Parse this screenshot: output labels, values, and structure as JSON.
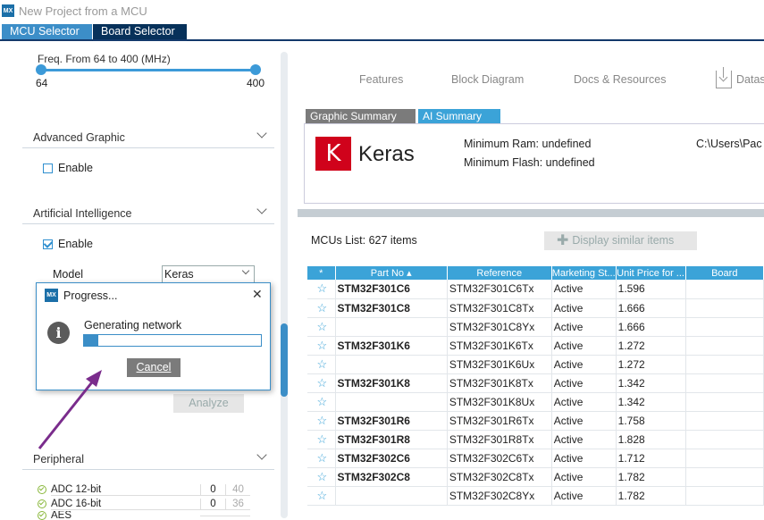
{
  "window": {
    "logo": "MX",
    "title": "New Project from a MCU"
  },
  "tabs": [
    {
      "label": "MCU Selector"
    },
    {
      "label": "Board Selector"
    }
  ],
  "filters": {
    "freq_label": "Freq.  From 64 to 400 (MHz)",
    "freq_min": "64",
    "freq_max": "400",
    "advanced_graphic": {
      "title": "Advanced Graphic",
      "enable_label": "Enable",
      "checked": false
    },
    "ai": {
      "title": "Artificial Intelligence",
      "enable_label": "Enable",
      "checked": true,
      "model_label": "Model",
      "model_value": "Keras",
      "analyze_label": "Analyze"
    },
    "peripheral": {
      "title": "Peripheral",
      "rows": [
        {
          "name": "ADC 12-bit",
          "v1": "0",
          "v2": "40"
        },
        {
          "name": "ADC 16-bit",
          "v1": "0",
          "v2": "36"
        },
        {
          "name": "AES",
          "v1": "",
          "v2": ""
        }
      ]
    }
  },
  "right": {
    "tabs": {
      "features": "Features",
      "block_diagram": "Block Diagram",
      "docs": "Docs & Resources",
      "datasheet": "Datas"
    },
    "subtabs": {
      "graphic": "Graphic Summary",
      "ai": "AI Summary"
    },
    "summary": {
      "logo_letter": "K",
      "name": "Keras",
      "min_ram": "Minimum Ram: undefined",
      "min_flash": "Minimum Flash: undefined",
      "path": "C:\\Users\\Pac"
    },
    "mcus_list": "MCUs List: 627 items",
    "similar_button": "Display similar items",
    "table": {
      "headers": {
        "star": "*",
        "part": "Part No",
        "reference": "Reference",
        "marketing": "Marketing St...",
        "price": "Unit Price for ...",
        "board": "Board"
      },
      "rows": [
        {
          "part": "STM32F301C6",
          "reference": "STM32F301C6Tx",
          "status": "Active",
          "price": "1.596"
        },
        {
          "part": "STM32F301C8",
          "reference": "STM32F301C8Tx",
          "status": "Active",
          "price": "1.666"
        },
        {
          "part": "",
          "reference": "STM32F301C8Yx",
          "status": "Active",
          "price": "1.666"
        },
        {
          "part": "STM32F301K6",
          "reference": "STM32F301K6Tx",
          "status": "Active",
          "price": "1.272"
        },
        {
          "part": "",
          "reference": "STM32F301K6Ux",
          "status": "Active",
          "price": "1.272"
        },
        {
          "part": "STM32F301K8",
          "reference": "STM32F301K8Tx",
          "status": "Active",
          "price": "1.342"
        },
        {
          "part": "",
          "reference": "STM32F301K8Ux",
          "status": "Active",
          "price": "1.342"
        },
        {
          "part": "STM32F301R6",
          "reference": "STM32F301R6Tx",
          "status": "Active",
          "price": "1.758"
        },
        {
          "part": "STM32F301R8",
          "reference": "STM32F301R8Tx",
          "status": "Active",
          "price": "1.828"
        },
        {
          "part": "STM32F302C6",
          "reference": "STM32F302C6Tx",
          "status": "Active",
          "price": "1.712"
        },
        {
          "part": "STM32F302C8",
          "reference": "STM32F302C8Tx",
          "status": "Active",
          "price": "1.782"
        },
        {
          "part": "",
          "reference": "STM32F302C8Yx",
          "status": "Active",
          "price": "1.782"
        }
      ]
    }
  },
  "dialog": {
    "logo": "MX",
    "title": "Progress...",
    "close": "✕",
    "message": "Generating network",
    "progress": 0.08,
    "cancel": "Cancel"
  },
  "colors": {
    "accent": "#3ba3d8",
    "dark_tab": "#07315a",
    "keras_red": "#d0021b",
    "arrow": "#7a2c8c"
  }
}
